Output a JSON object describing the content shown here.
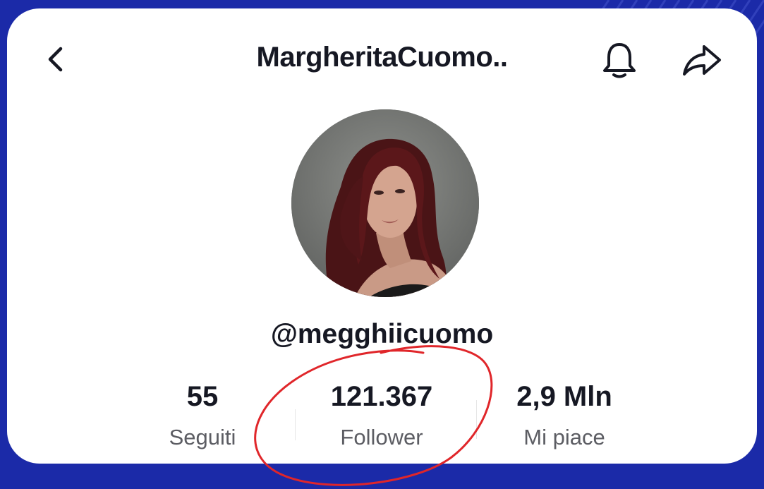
{
  "header": {
    "title": "MargheritaCuomo..",
    "back_icon": "chevron-left-icon",
    "bell_icon": "bell-icon",
    "share_icon": "share-arrow-icon"
  },
  "profile": {
    "handle": "@megghiicuomo",
    "avatar": "profile-photo"
  },
  "stats": [
    {
      "value": "55",
      "label": "Seguiti"
    },
    {
      "value": "121.367",
      "label": "Follower"
    },
    {
      "value": "2,9 Mln",
      "label": "Mi piace"
    }
  ],
  "colors": {
    "background": "#1b2aa8",
    "card": "#ffffff",
    "text": "#161823",
    "secondary_text": "#5c5d63",
    "annotation": "#e0262a"
  }
}
